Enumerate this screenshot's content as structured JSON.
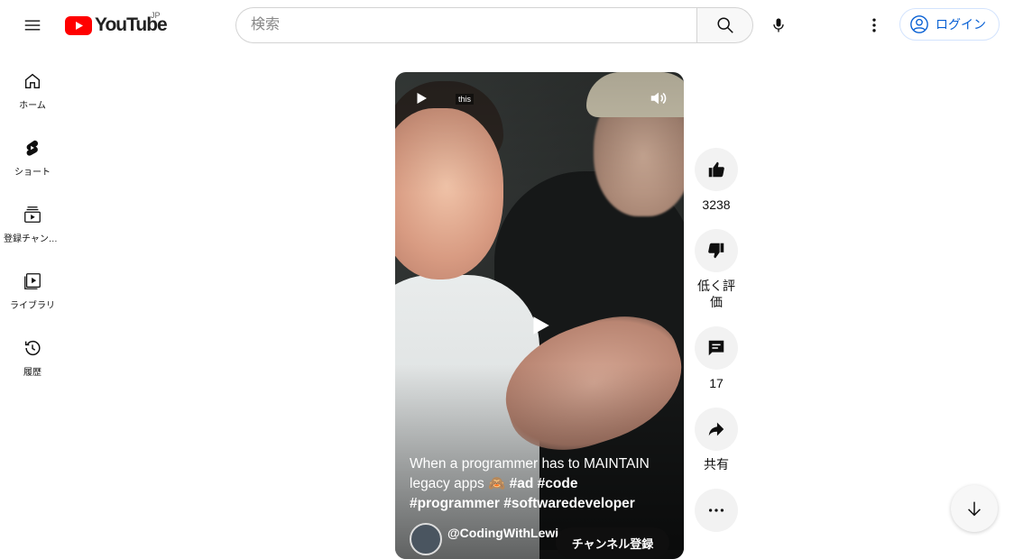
{
  "header": {
    "logo_text": "YouTube",
    "region": "JP",
    "search_placeholder": "検索",
    "login_label": "ログイン"
  },
  "sidebar": {
    "items": [
      {
        "label": "ホーム",
        "icon": "home-icon"
      },
      {
        "label": "ショート",
        "icon": "shorts-icon"
      },
      {
        "label": "登録チャンネル",
        "icon": "subscriptions-icon"
      },
      {
        "label": "ライブラリ",
        "icon": "library-icon"
      },
      {
        "label": "履歴",
        "icon": "history-icon"
      }
    ]
  },
  "video": {
    "overlay_text": "this",
    "title_prefix": "When a programmer has to MAINTAIN legacy apps 🙈 ",
    "hashtags": "#ad #code #programmer #softwaredeveloper",
    "channel": "@CodingWithLewi",
    "subscribe_label": "チャンネル登録"
  },
  "actions": {
    "like_count": "3238",
    "dislike_label": "低く評価",
    "comment_count": "17",
    "share_label": "共有"
  },
  "colors": {
    "brand_red": "#ff0000",
    "link_blue": "#065fd4",
    "action_bg": "#f2f2f2"
  }
}
